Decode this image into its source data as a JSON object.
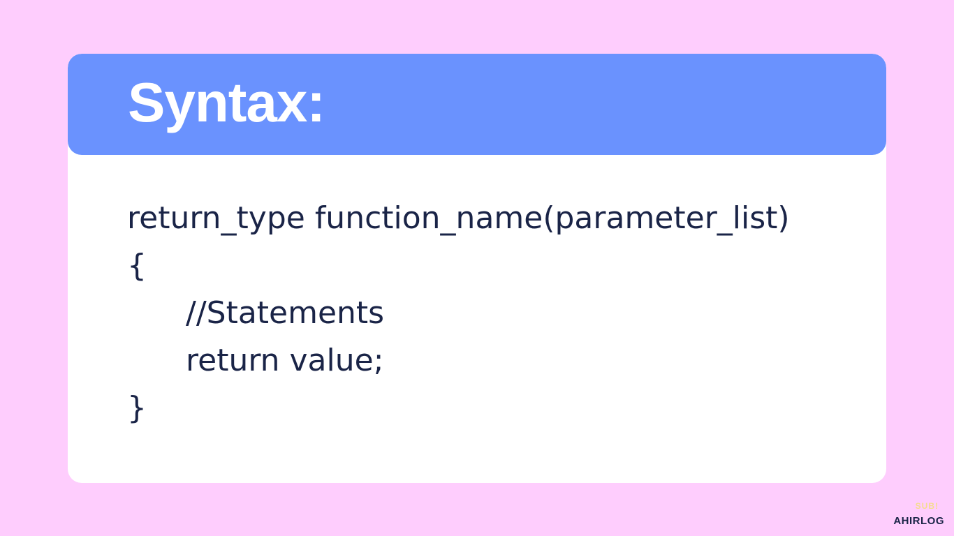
{
  "slide": {
    "title": "Syntax:",
    "code_lines": [
      "return_type function_name(parameter_list)",
      "{",
      "//Statements",
      "return value;",
      "}"
    ]
  },
  "watermark": {
    "small_text": "SUB!",
    "brand": "AHIRLOG"
  },
  "colors": {
    "background": "#fecdfd",
    "header": "#6a92fe",
    "card": "#ffffff",
    "code_text": "#1a2447",
    "title_text": "#ffffff"
  }
}
